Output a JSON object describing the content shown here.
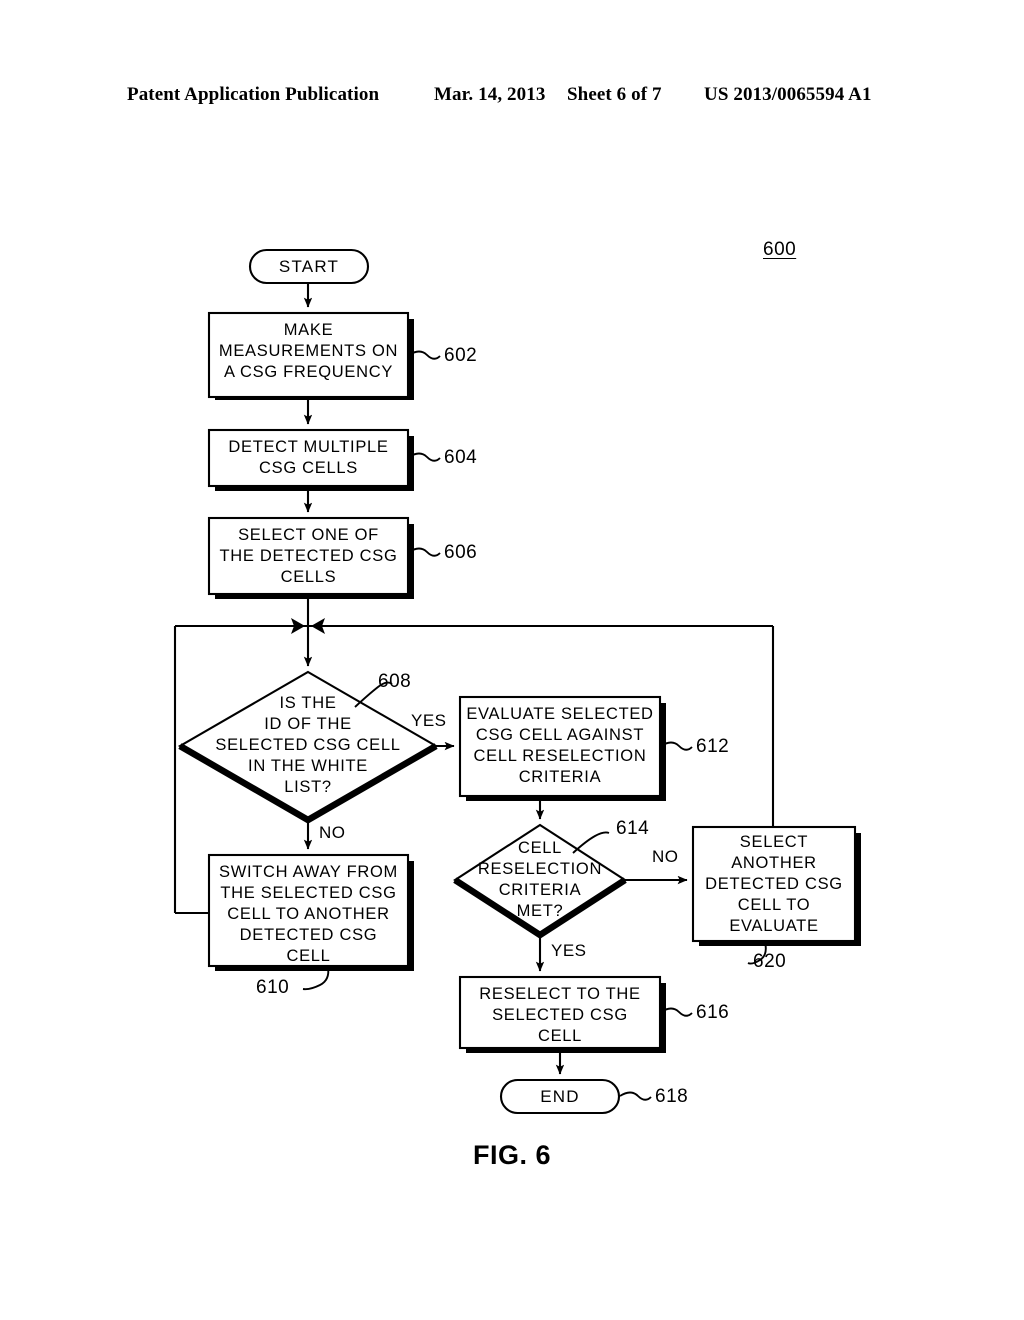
{
  "header": {
    "publication": "Patent Application Publication",
    "date": "Mar. 14, 2013",
    "sheet": "Sheet 6 of 7",
    "patent_number": "US 2013/0065594 A1"
  },
  "figure": {
    "caption": "FIG. 6",
    "figure_ref": "600",
    "nodes": {
      "start": {
        "label": "START",
        "type": "terminator"
      },
      "n602": {
        "label": "MAKE\nMEASUREMENTS  ON\nA  CSG  FREQUENCY",
        "ref": "602",
        "type": "process"
      },
      "n604": {
        "label": "DETECT  MULTIPLE\nCSG  CELLS",
        "ref": "604",
        "type": "process"
      },
      "n606": {
        "label": "SELECT  ONE  OF\nTHE  DETECTED  CSG\nCELLS",
        "ref": "606",
        "type": "process"
      },
      "n608": {
        "label": "IS  THE\nID  OF  THE\nSELECTED  CSG  CELL\nIN  THE  WHITE\nLIST?",
        "ref": "608",
        "type": "decision"
      },
      "n610": {
        "label": "SWITCH  AWAY  FROM\nTHE  SELECTED  CSG\nCELL  TO  ANOTHER\nDETECTED  CSG\nCELL",
        "ref": "610",
        "type": "process"
      },
      "n612": {
        "label": "EVALUATE  SELECTED\nCSG  CELL  AGAINST\nCELL  RESELECTION\nCRITERIA",
        "ref": "612",
        "type": "process"
      },
      "n614": {
        "label": "CELL\nRESELECTION\nCRITERIA\nMET?",
        "ref": "614",
        "type": "decision"
      },
      "n616": {
        "label": "RESELECT  TO  THE\nSELECTED  CSG\nCELL",
        "ref": "616",
        "type": "process"
      },
      "n618": {
        "label": "END",
        "ref": "618",
        "type": "terminator"
      },
      "n620": {
        "label": "SELECT\nANOTHER\nDETECTED  CSG\nCELL  TO\nEVALUATE",
        "ref": "620",
        "type": "process"
      }
    },
    "branch_labels": {
      "yes_608": "YES",
      "no_608": "NO",
      "no_614": "NO",
      "yes_614": "YES"
    },
    "colors": {
      "stroke": "#000000",
      "fill": "#ffffff",
      "shadow": "#000000"
    }
  }
}
